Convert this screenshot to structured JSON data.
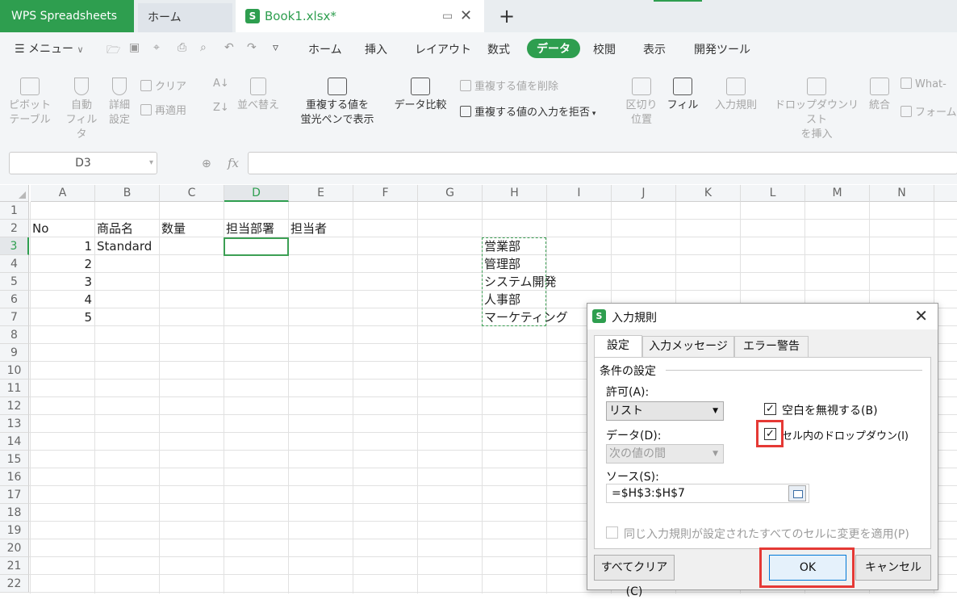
{
  "titlebar": {
    "app_name": "WPS Spreadsheets",
    "home_tab": "ホーム",
    "file_tab": "Book1.xlsx*",
    "sheet_icon_letter": "S"
  },
  "menu": {
    "menu_label": "メニュー",
    "tabs": [
      "ホーム",
      "挿入",
      "レイアウト",
      "数式",
      "データ",
      "校閲",
      "表示",
      "開発ツール"
    ],
    "active_tab": "データ"
  },
  "ribbon": {
    "pivot": "ピボット\nテーブル",
    "autofilter": "自動\nフィルタ",
    "advanced": "詳細\n設定",
    "clear": "クリア",
    "reapply": "再適用",
    "sort": "並べ替え",
    "highlight_dup": "重複する値を\n蛍光ペンで表示",
    "compare": "データ比較",
    "remove_dup": "重複する値を削除",
    "reject_dup": "重複する値の入力を拒否",
    "split": "区切り\n位置",
    "fill": "フィル",
    "validation": "入力規則",
    "dropdown": "ドロップダウンリスト\nを挿入",
    "consolidate": "統合",
    "whatif": "What-",
    "form": "フォーム"
  },
  "formula_bar": {
    "name_box": "D3",
    "fx_label": "fx",
    "formula": ""
  },
  "grid": {
    "columns": [
      "A",
      "B",
      "C",
      "D",
      "E",
      "F",
      "G",
      "H",
      "I",
      "J",
      "K",
      "L",
      "M",
      "N"
    ],
    "rows": [
      "1",
      "2",
      "3",
      "4",
      "5",
      "6",
      "7",
      "8",
      "9",
      "10",
      "11",
      "12",
      "13",
      "14",
      "15",
      "16",
      "17",
      "18",
      "19",
      "20",
      "21",
      "22"
    ],
    "selected_column": "D",
    "selected_row": "3",
    "header_row": [
      "No",
      "商品名",
      "数量",
      "担当部署",
      "担当者"
    ],
    "numbers": [
      "1",
      "2",
      "3",
      "4",
      "5"
    ],
    "b3": "Standard",
    "list_values": [
      "営業部",
      "管理部",
      "システム開発",
      "人事部",
      "マーケティング"
    ]
  },
  "dialog": {
    "title": "入力規則",
    "tabs": [
      "設定",
      "入力メッセージ",
      "エラー警告"
    ],
    "group_label": "条件の設定",
    "allow_label": "許可(A):",
    "allow_value": "リスト",
    "data_label": "データ(D):",
    "data_value": "次の値の間",
    "ignore_blank": "空白を無視する(B)",
    "in_cell_dropdown": "セル内のドロップダウン(I)",
    "source_label": "ソース(S):",
    "source_value": "=$H$3:$H$7",
    "apply_all": "同じ入力規則が設定されたすべてのセルに変更を適用(P)",
    "clear_all": "すべてクリア(C)",
    "ok": "OK",
    "cancel": "キャンセル",
    "check_mark": "✓"
  },
  "colors": {
    "brand_green": "#2e9e4f",
    "highlight_red": "#e53935"
  }
}
